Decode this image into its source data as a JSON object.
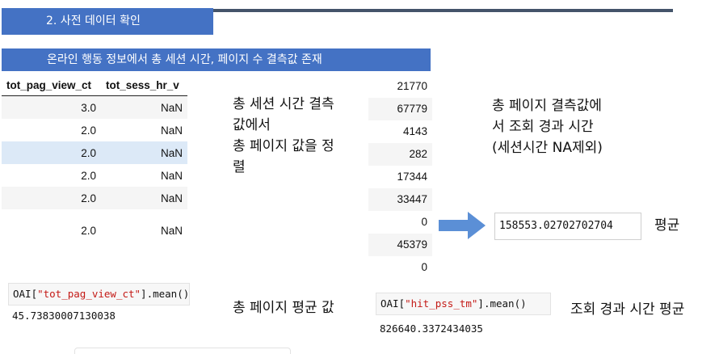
{
  "section_title": "2. 사전 데이터 확인",
  "subtitle": "온라인 행동 정보에서 총 세션 시간, 페이지 수 결측값 존재",
  "table": {
    "headers": [
      "tot_pag_view_ct",
      "tot_sess_hr_v"
    ],
    "rows": [
      [
        "3.0",
        "NaN"
      ],
      [
        "2.0",
        "NaN"
      ],
      [
        "2.0",
        "NaN"
      ],
      [
        "2.0",
        "NaN"
      ],
      [
        "2.0",
        "NaN"
      ],
      [
        "2.0",
        "NaN"
      ]
    ]
  },
  "note_sort": [
    "총 세션 시간 결측",
    "값에서",
    "총 페이지 값을 정",
    "렬"
  ],
  "values_column": [
    "21770",
    "67779",
    "4143",
    "282",
    "17344",
    "33447",
    "0",
    "45379",
    "0"
  ],
  "note_view_time": [
    "총 페이지 결측값에",
    "서 조회 경과 시간",
    "(세션시간 NA제외)"
  ],
  "mean_result": "158553.02702702704",
  "mean_label": "평균",
  "code1": {
    "prefix": "OAI[",
    "arg": "\"tot_pag_view_ct\"",
    "suffix": "].mean()",
    "output": "45.73830007130038"
  },
  "code1_label": "총 페이지 평균 값",
  "code2": {
    "prefix": "OAI[",
    "arg": "\"hit_pss_tm\"",
    "suffix": "].mean()",
    "output": "826640.3372434035"
  },
  "code2_label": "조회 경과 시간 평균",
  "colors": {
    "accent": "#4472c4",
    "rule": "#44546a",
    "arrow": "#5b8fd6",
    "highlight_row": "#dce9f7"
  }
}
